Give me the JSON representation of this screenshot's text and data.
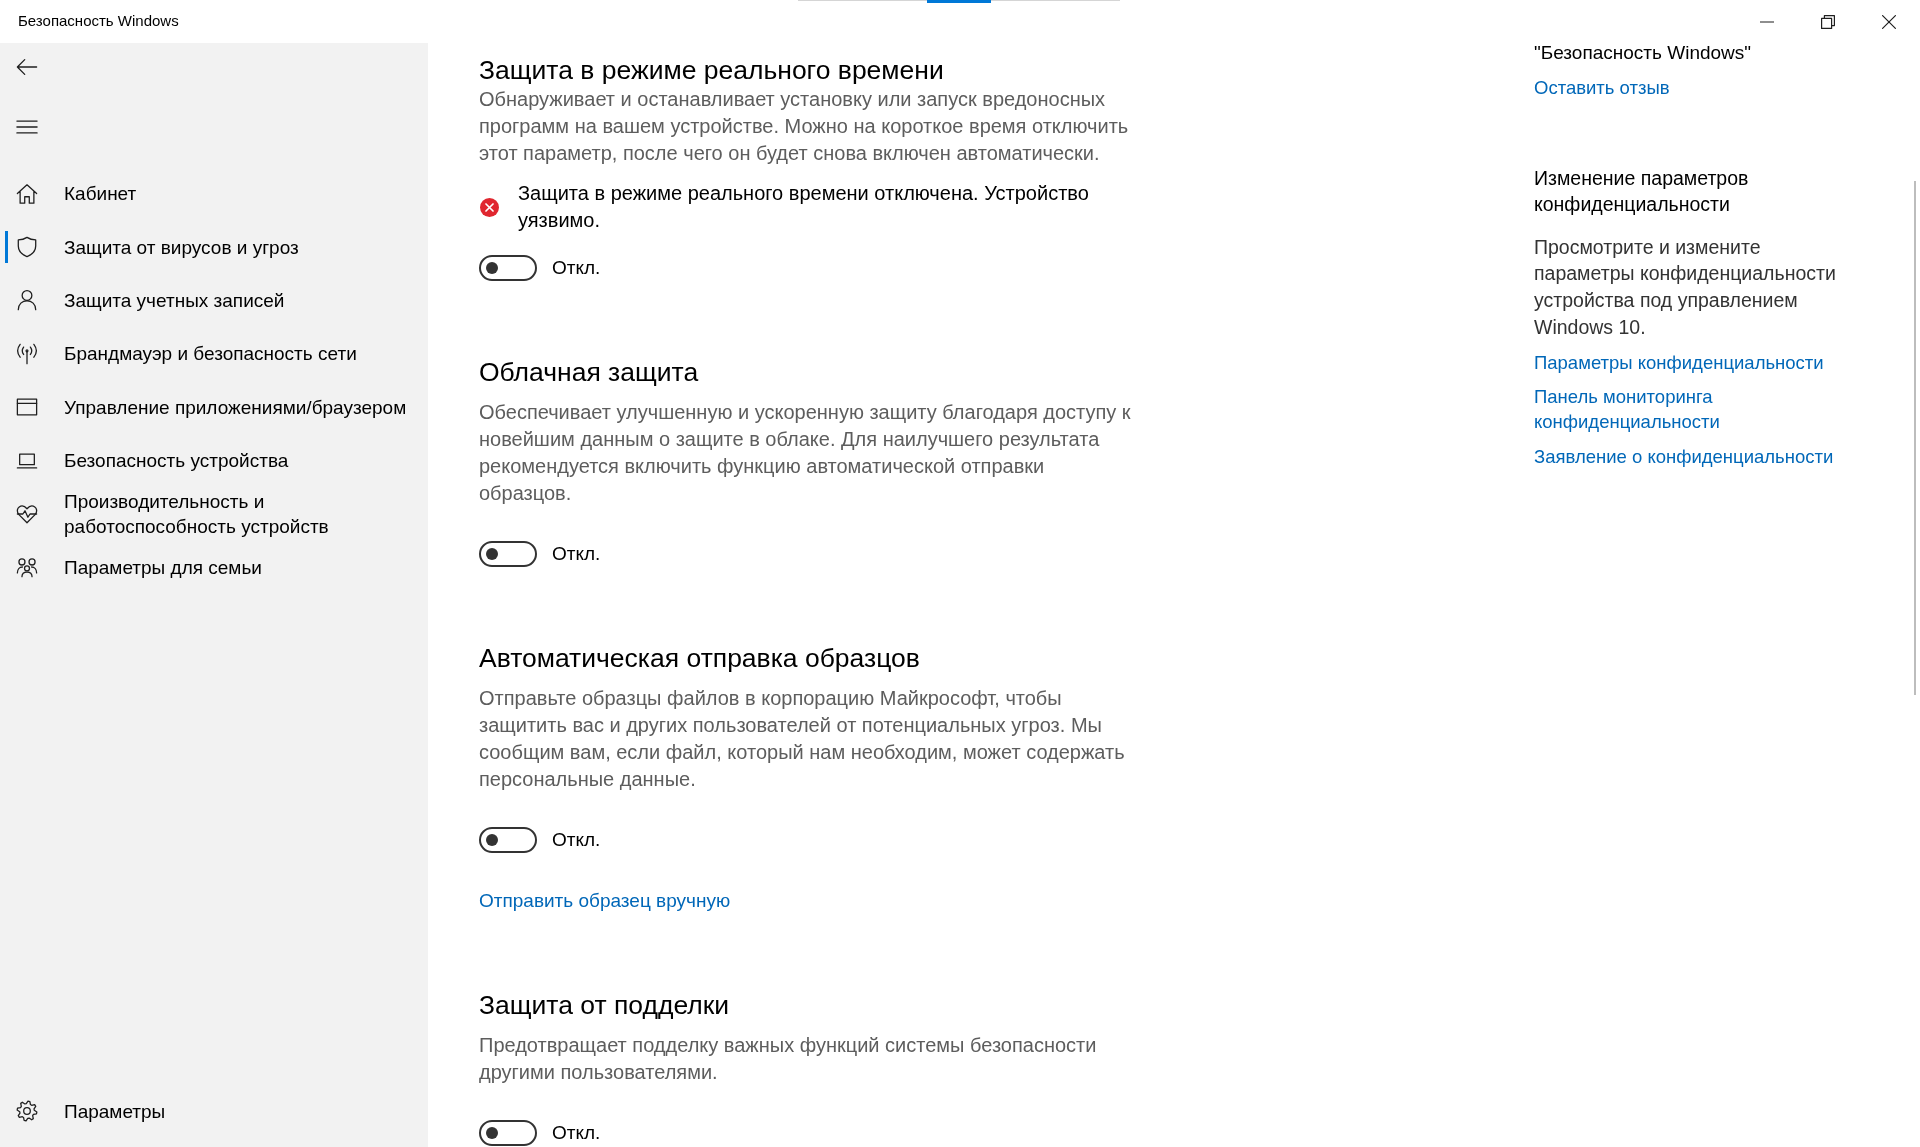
{
  "window": {
    "title": "Безопасность Windows"
  },
  "sidebar": {
    "items": [
      {
        "label": "Кабинет",
        "selected": false
      },
      {
        "label": "Защита от вирусов и угроз",
        "selected": true
      },
      {
        "label": "Защита учетных записей",
        "selected": false
      },
      {
        "label": "Брандмауэр и безопасность сети",
        "selected": false
      },
      {
        "label": "Управление приложениями/браузером",
        "selected": false
      },
      {
        "label": "Безопасность устройства",
        "selected": false
      },
      {
        "label": "Производительность и работоспособность устройств",
        "selected": false
      },
      {
        "label": "Параметры для семьи",
        "selected": false
      }
    ],
    "footer_item": {
      "label": "Параметры"
    }
  },
  "sections": [
    {
      "heading": "Защита в режиме реального времени",
      "description": "Обнаруживает и останавливает установку или запуск вредоносных программ на вашем устройстве. Можно на короткое время отключить этот параметр, после чего он будет снова включен автоматически.",
      "status": {
        "kind": "error",
        "text": "Защита в режиме реального времени отключена. Устройство уязвимо."
      },
      "toggle": {
        "on": false,
        "label": "Откл."
      }
    },
    {
      "heading": "Облачная защита",
      "description": "Обеспечивает улучшенную и ускоренную защиту благодаря доступу к новейшим данным о защите в облаке. Для наилучшего результата рекомендуется включить функцию автоматической отправки образцов.",
      "toggle": {
        "on": false,
        "label": "Откл."
      }
    },
    {
      "heading": "Автоматическая отправка образцов",
      "description": "Отправьте образцы файлов в корпорацию Майкрософт, чтобы защитить вас и других пользователей от потенциальных угроз. Мы сообщим вам, если файл, который нам необходим, может содержать персональные данные.",
      "toggle": {
        "on": false,
        "label": "Откл."
      },
      "link": "Отправить образец вручную"
    },
    {
      "heading": "Защита от подделки",
      "description": "Предотвращает подделку важных функций системы безопасности другими пользователями.",
      "toggle": {
        "on": false,
        "label": "Откл."
      }
    }
  ],
  "right_panel": {
    "about_title": "\"Безопасность Windows\"",
    "feedback_link": "Оставить отзыв",
    "privacy_heading": "Изменение параметров конфиденциальности",
    "privacy_description": "Просмотрите и измените параметры конфиденциальности устройства под управлением Windows 10.",
    "links": [
      "Параметры конфиденциальности",
      "Панель мониторинга конфиденциальности",
      "Заявление о конфиденциальности"
    ]
  }
}
